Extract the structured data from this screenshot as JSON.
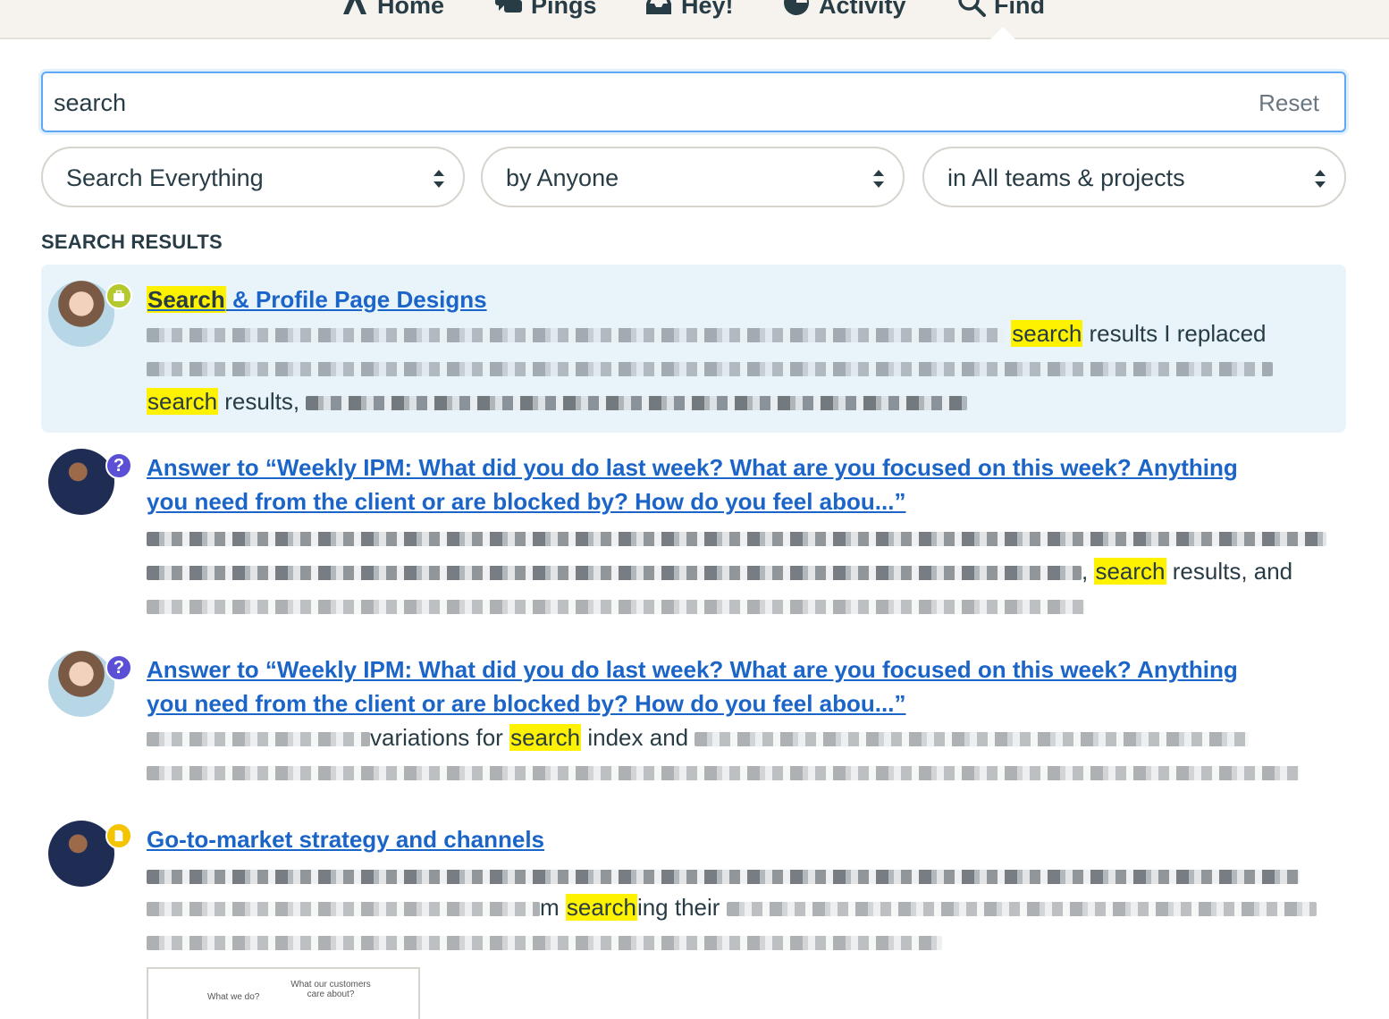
{
  "nav": {
    "items": [
      {
        "label": "Home",
        "icon": "home-icon"
      },
      {
        "label": "Pings",
        "icon": "chat-bubbles-icon"
      },
      {
        "label": "Hey!",
        "icon": "inbox-icon"
      },
      {
        "label": "Activity",
        "icon": "pie-clock-icon"
      },
      {
        "label": "Find",
        "icon": "magnifier-icon"
      }
    ],
    "active": "Find"
  },
  "search": {
    "value": "search",
    "reset_label": "Reset"
  },
  "filters": {
    "type": "Search Everything",
    "person": "by Anyone",
    "scope": "in All teams & projects"
  },
  "results_heading": "SEARCH RESULTS",
  "colors": {
    "link": "#1b64c8",
    "highlight": "#fff200",
    "selected_row": "#e8f4fa",
    "focus_border": "#5fa8f5",
    "badge_project": "#b4c92e",
    "badge_question": "#5b4fd6",
    "badge_doc": "#f5c400"
  },
  "results": [
    {
      "badge": "briefcase-icon",
      "title_match": "Search",
      "title_rest": " & Profile Page Designs",
      "line1_match": "search",
      "line1_after": " results I replaced",
      "line3_match": "search",
      "line3_after": " results,"
    },
    {
      "badge": "?",
      "title_line1": "Answer to “Weekly IPM: What did you do last week? What are you focused on this week? Anything",
      "title_line2": "you need from the client or are blocked by? How do you feel abou...”",
      "line2_before": ",",
      "line2_match": "search",
      "line2_after": " results, and"
    },
    {
      "badge": "?",
      "title_line1": "Answer to “Weekly IPM: What did you do last week? What are you focused on this week? Anything",
      "title_line2": "you need from the client or are blocked by? How do you feel abou...”",
      "line1_before": "variations for ",
      "line1_match": "search",
      "line1_after": " index and"
    },
    {
      "badge": "doc-icon",
      "title": "Go-to-market strategy and channels",
      "line2_before": "m ",
      "line2_match": "search",
      "line2_after": "ing their",
      "thumb_left": "What we do?",
      "thumb_right": "What our customers care about?"
    }
  ]
}
